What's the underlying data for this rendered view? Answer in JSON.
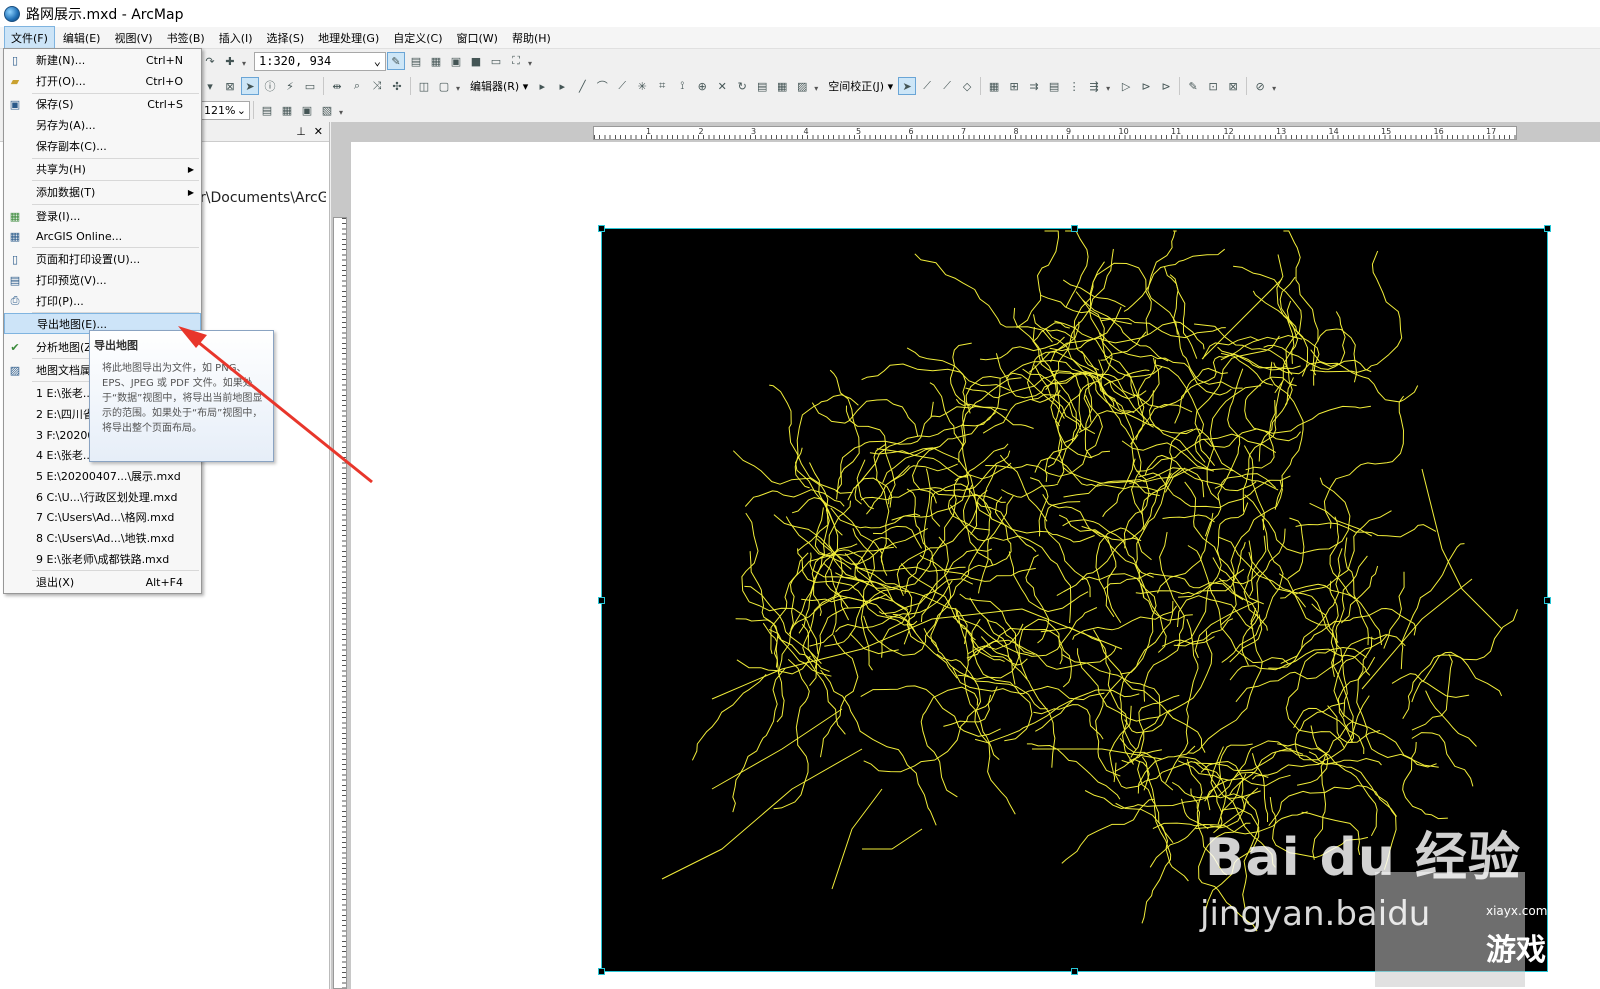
{
  "window": {
    "title": "路网展示.mxd - ArcMap"
  },
  "menubar": [
    "文件(F)",
    "编辑(E)",
    "视图(V)",
    "书签(B)",
    "插入(I)",
    "选择(S)",
    "地理处理(G)",
    "自定义(C)",
    "窗口(W)",
    "帮助(H)"
  ],
  "toolbar": {
    "scale": "1:320, 934",
    "editor_label": "编辑器(R) ▾",
    "spatial_adjust_label": "空间校正(J) ▾",
    "zoom": "121%"
  },
  "toc": {
    "path_text": "r\\Documents\\ArcG"
  },
  "file_menu": {
    "new": {
      "label": "新建(N)...",
      "shortcut": "Ctrl+N"
    },
    "open": {
      "label": "打开(O)...",
      "shortcut": "Ctrl+O"
    },
    "save": {
      "label": "保存(S)",
      "shortcut": "Ctrl+S"
    },
    "save_as": {
      "label": "另存为(A)..."
    },
    "save_copy": {
      "label": "保存副本(C)..."
    },
    "share_as": {
      "label": "共享为(H)"
    },
    "add_data": {
      "label": "添加数据(T)"
    },
    "sign_in": {
      "label": "登录(I)..."
    },
    "arcgis_online": {
      "label": "ArcGIS Online..."
    },
    "page_setup": {
      "label": "页面和打印设置(U)..."
    },
    "print_preview": {
      "label": "打印预览(V)..."
    },
    "print": {
      "label": "打印(P)..."
    },
    "export_map": {
      "label": "导出地图(E)..."
    },
    "analyze_map": {
      "label": "分析地图(Z"
    },
    "map_doc_props": {
      "label": "地图文档属"
    },
    "recent": [
      "1 E:\\张老...",
      "2 E:\\四川省",
      "3 F:\\20200",
      "4 E:\\张老...",
      "5 E:\\20200407...\\展示.mxd",
      "6 C:\\U...\\行政区划处理.mxd",
      "7 C:\\Users\\Ad...\\格网.mxd",
      "8 C:\\Users\\Ad...\\地铁.mxd",
      "9 E:\\张老师\\成都铁路.mxd"
    ],
    "exit": {
      "label": "退出(X)",
      "shortcut": "Alt+F4"
    }
  },
  "tooltip": {
    "title": "导出地图",
    "body": "将此地图导出为文件，如 PNG、EPS、JPEG 或 PDF 文件。如果处于“数据”视图中，将导出当前地图显示的范围。如果处于“布局”视图中，将导出整个页面布局。"
  },
  "ruler": {
    "h_numbers": [
      "1",
      "2",
      "3",
      "4",
      "5",
      "6",
      "7",
      "8",
      "9",
      "10",
      "11",
      "12",
      "13",
      "14",
      "15",
      "16",
      "17"
    ]
  },
  "watermark": {
    "baidu": "Bai du 经验",
    "url": "jingyan.baidu",
    "site": "xiayx.com",
    "game": "游戏"
  },
  "colors": {
    "roads": "#f2ee3a",
    "frame": "#27c6d6",
    "highlight": "#cde4f8",
    "arrow": "#e8362b"
  }
}
